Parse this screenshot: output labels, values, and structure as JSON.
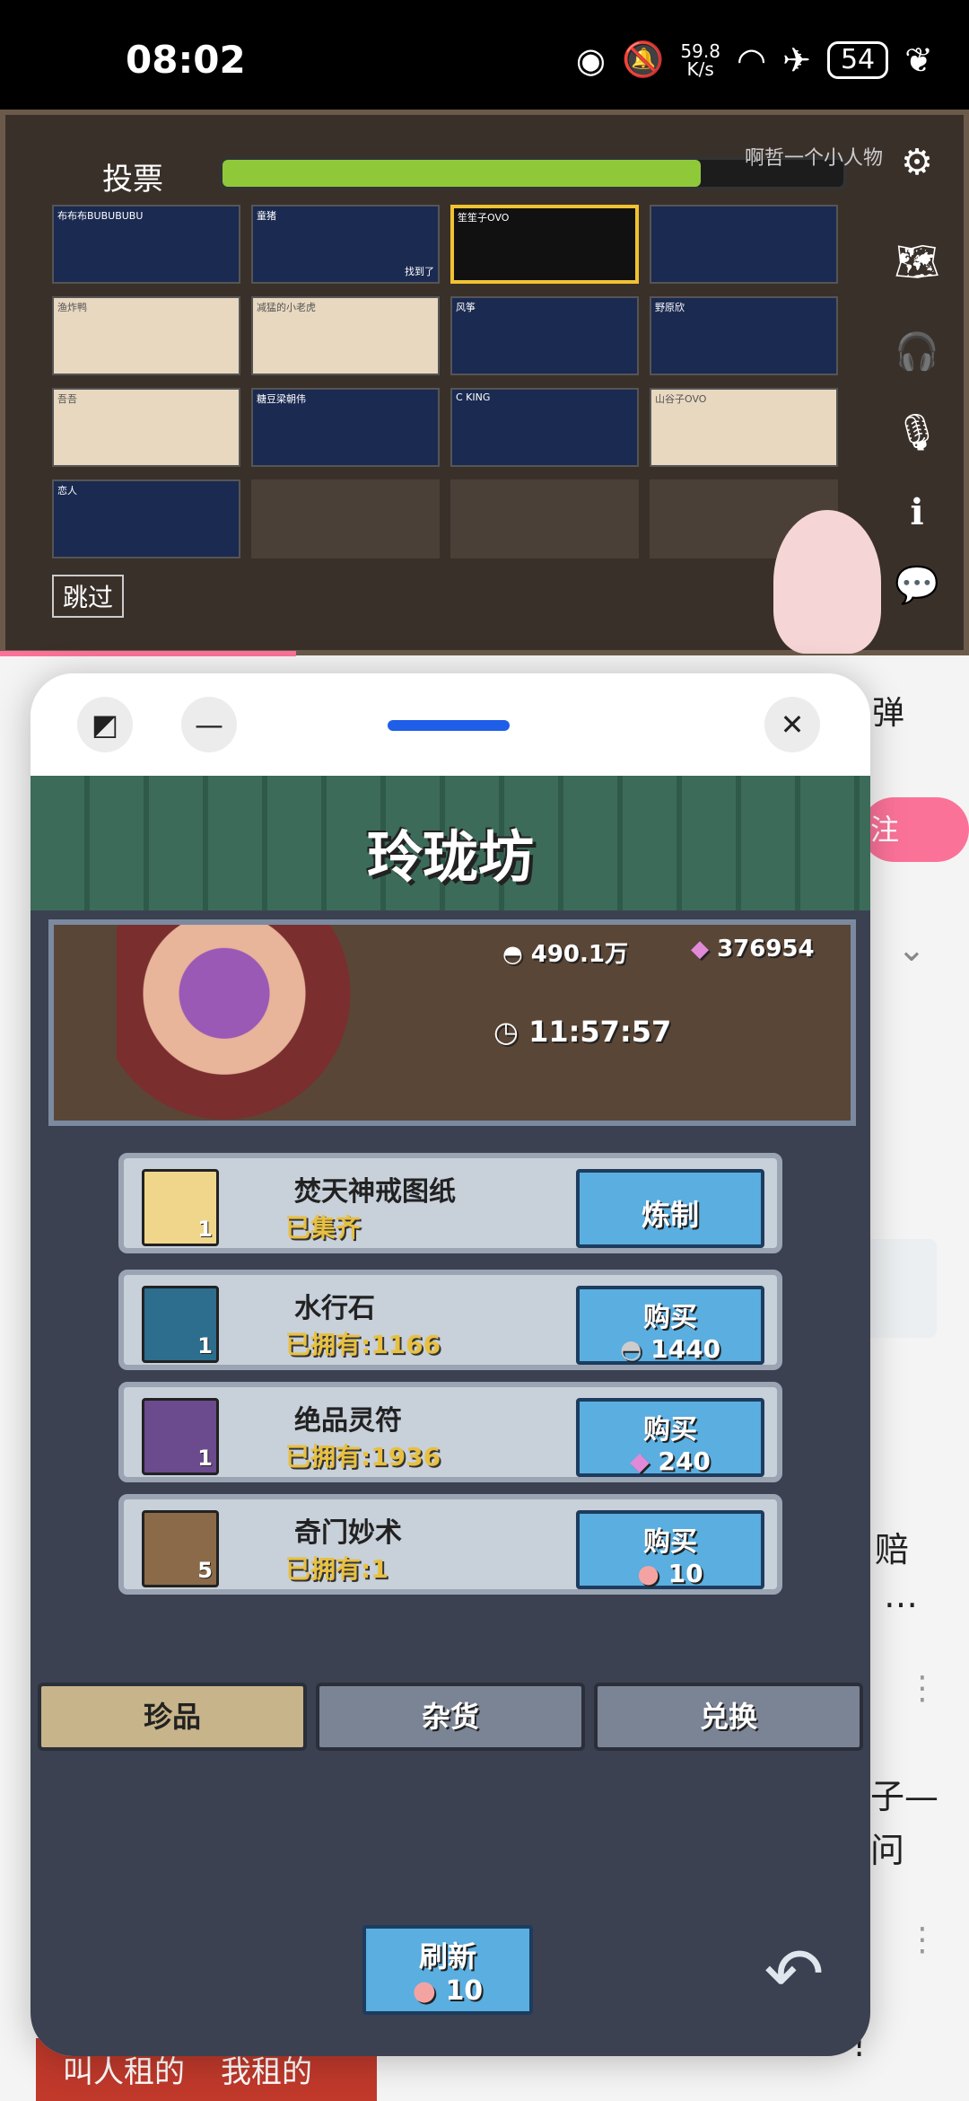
{
  "status_bar": {
    "time": "08:02",
    "speed_value": "59.8",
    "speed_unit": "K/s",
    "battery": "54"
  },
  "video": {
    "vote_title": "投票",
    "vote_progress": 0.77,
    "streamer": "啊哲一个小人物",
    "players": [
      {
        "name": "布布布BUBUBUBU",
        "style": "dark"
      },
      {
        "name": "童猪",
        "style": "dark",
        "note": "找到了"
      },
      {
        "name": "笙笙子OVO",
        "style": "selected"
      },
      {
        "name": "",
        "style": "dark"
      },
      {
        "name": "渔炸鸭",
        "style": "light"
      },
      {
        "name": "减猛的小老虎",
        "style": "light"
      },
      {
        "name": "风筝",
        "style": "dark"
      },
      {
        "name": "野原欣",
        "style": "dark"
      },
      {
        "name": "吾吾",
        "style": "light"
      },
      {
        "name": "糖豆梁朝伟",
        "style": "dark"
      },
      {
        "name": "C KING",
        "style": "dark"
      },
      {
        "name": "山谷子OVO",
        "style": "light"
      },
      {
        "name": "恋人",
        "style": "dark"
      },
      {
        "name": "",
        "style": "empty"
      },
      {
        "name": "",
        "style": "empty"
      },
      {
        "name": "",
        "style": "empty"
      }
    ],
    "skip_label": "跳过"
  },
  "background_page": {
    "follow_label": "注",
    "danmaku_label": "弹",
    "snippet1": "赔",
    "snippet1b": "…",
    "snippet2": "子—",
    "snippet2b": "问",
    "snippet3": "!",
    "bottom_left": "叫人租的",
    "bottom_right": "我租的"
  },
  "floating_window": {
    "game": {
      "shop_title": "玲珑坊",
      "silver": "490.1万",
      "gems": "376954",
      "timer": "11:57:57",
      "items": [
        {
          "name": "焚天神戒图纸",
          "owned": "已集齐",
          "qty": "1",
          "button": "炼制",
          "price": "",
          "color": "#f0d68a"
        },
        {
          "name": "水行石",
          "owned": "已拥有:1166",
          "qty": "1",
          "button": "购买",
          "price": "1440",
          "color": "#2d6d8e"
        },
        {
          "name": "绝品灵符",
          "owned": "已拥有:1936",
          "qty": "1",
          "button": "购买",
          "price": "240",
          "color": "#6b4a8e"
        },
        {
          "name": "奇门妙术",
          "owned": "已拥有:1",
          "qty": "5",
          "button": "购买",
          "price": "10",
          "color": "#8a6a48"
        }
      ],
      "tabs": [
        "珍品",
        "杂货",
        "兑换"
      ],
      "refresh_label": "刷新",
      "refresh_cost": "10"
    }
  }
}
